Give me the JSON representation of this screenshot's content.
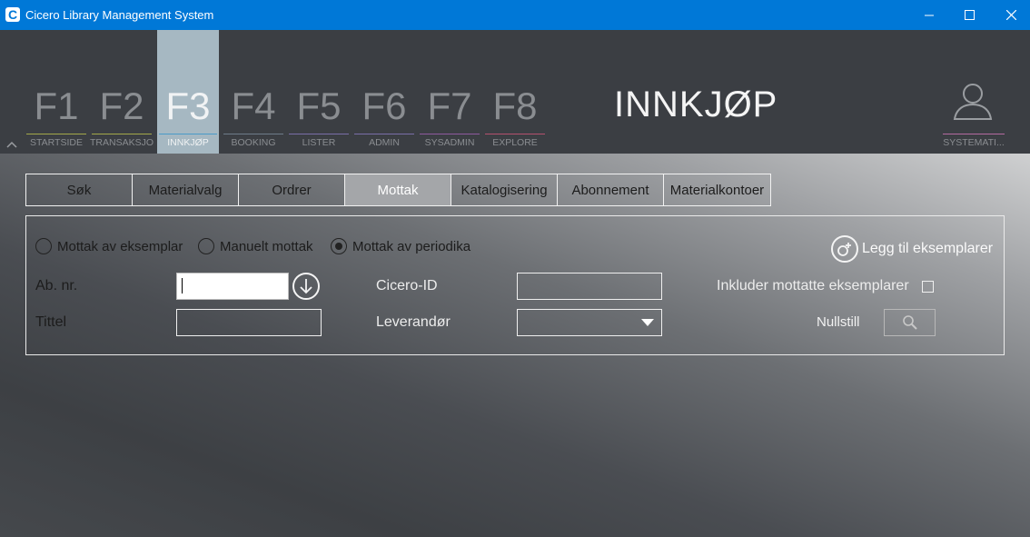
{
  "window": {
    "title": "Cicero Library Management System",
    "logo_letter": "C"
  },
  "header": {
    "page_title": "INNKJØP",
    "fkeys": [
      {
        "key": "F1",
        "label": "STARTSIDE",
        "color": "#a3a84a",
        "active": false
      },
      {
        "key": "F2",
        "label": "TRANSAKSJONER",
        "color": "#a3a84a",
        "active": false
      },
      {
        "key": "F3",
        "label": "INNKJØP",
        "color": "#4a9ac8",
        "active": true
      },
      {
        "key": "F4",
        "label": "BOOKING",
        "color": "#6e7c8a",
        "active": false
      },
      {
        "key": "F5",
        "label": "LISTER",
        "color": "#7a6ea8",
        "active": false
      },
      {
        "key": "F6",
        "label": "ADMIN",
        "color": "#7a6ea8",
        "active": false
      },
      {
        "key": "F7",
        "label": "SYSADMIN",
        "color": "#8e5a9e",
        "active": false
      },
      {
        "key": "F8",
        "label": "EXPLORE",
        "color": "#b4506e",
        "active": false
      }
    ],
    "user_label": "SYSTEMATI..."
  },
  "tabs": [
    {
      "label": "Søk",
      "active": false
    },
    {
      "label": "Materialvalg",
      "active": false
    },
    {
      "label": "Ordrer",
      "active": false
    },
    {
      "label": "Mottak",
      "active": true
    },
    {
      "label": "Katalogisering",
      "active": false
    },
    {
      "label": "Abonnement",
      "active": false
    },
    {
      "label": "Materialkontoer",
      "active": false
    }
  ],
  "receive": {
    "radio_1": "Mottak av eksemplar",
    "radio_2": "Manuelt mottak",
    "radio_3": "Mottak av periodika",
    "selected_radio": "Mottak av periodika",
    "add_copies": "Legg til eksemplarer",
    "ab_nr_label": "Ab. nr.",
    "ab_nr_value": "",
    "title_label": "Tittel",
    "title_value": "",
    "cicero_id_label": "Cicero-ID",
    "cicero_id_value": "",
    "supplier_label": "Leverandør",
    "supplier_value": "",
    "include_received_label": "Inkluder mottatte eksemplarer",
    "include_received_checked": false,
    "reset_label": "Nullstill"
  }
}
